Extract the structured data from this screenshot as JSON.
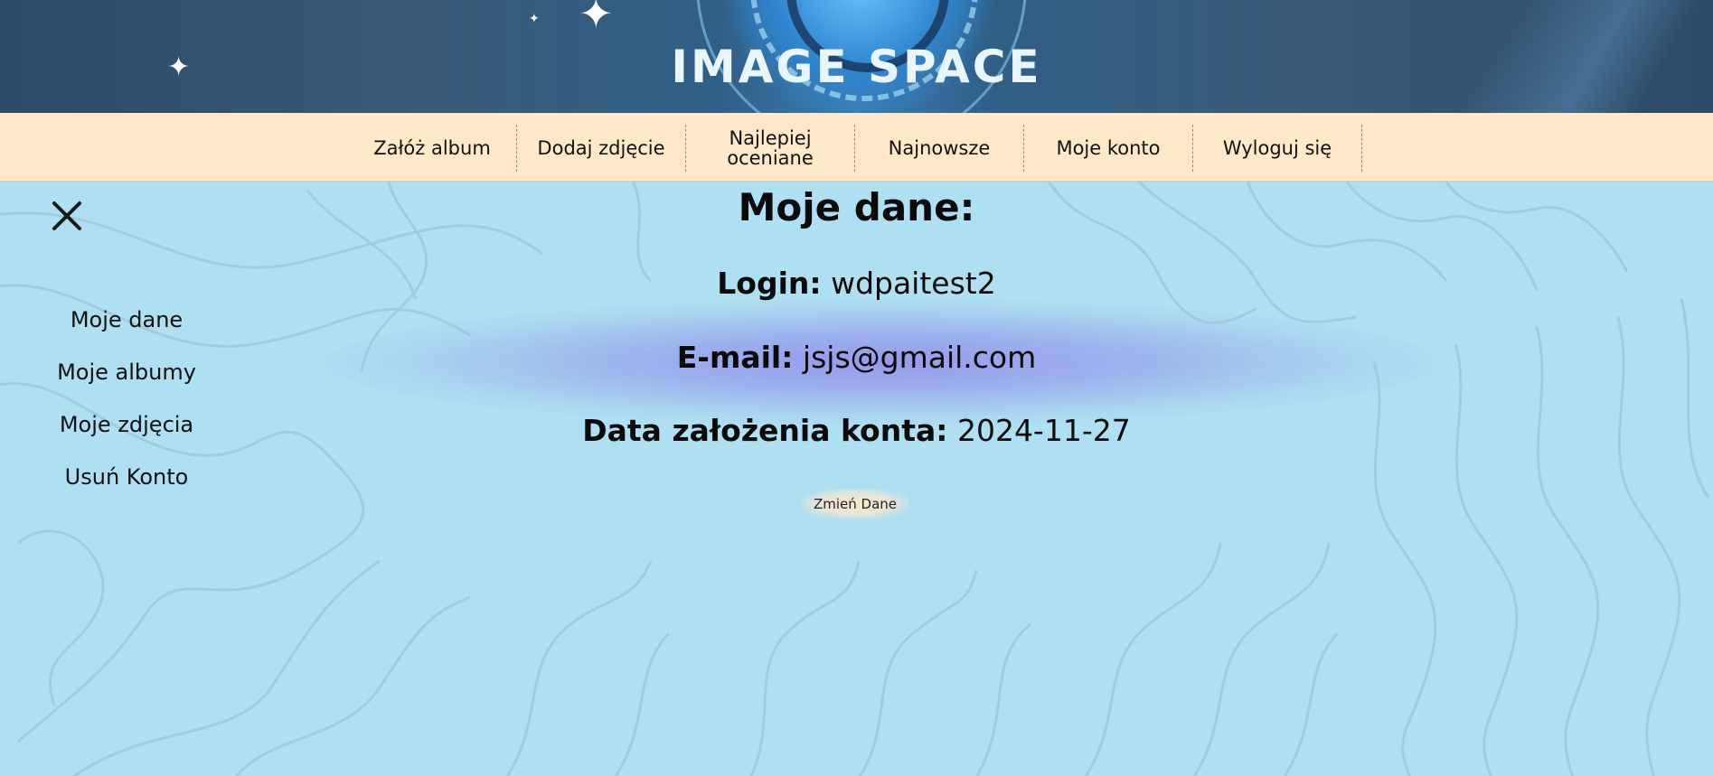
{
  "header": {
    "brand": "IMAGE SPACE"
  },
  "nav": {
    "items": [
      {
        "line1": "Załóż album",
        "line2": ""
      },
      {
        "line1": "Dodaj zdjęcie",
        "line2": ""
      },
      {
        "line1": "Najlepiej",
        "line2": "oceniane"
      },
      {
        "line1": "Najnowsze",
        "line2": ""
      },
      {
        "line1": "Moje konto",
        "line2": ""
      },
      {
        "line1": "Wyloguj się",
        "line2": ""
      }
    ]
  },
  "sidebar": {
    "close_icon": "close-icon",
    "items": [
      {
        "label": "Moje dane"
      },
      {
        "label": "Moje albumy"
      },
      {
        "label": "Moje zdjęcia"
      },
      {
        "label": "Usuń Konto"
      }
    ]
  },
  "main": {
    "title": "Moje dane:",
    "login_label": "Login:",
    "login_value": "wdpaitest2",
    "email_label": "E-mail:",
    "email_value": "jsjs@gmail.com",
    "created_label": "Data założenia konta:",
    "created_value": "2024-11-27",
    "change_button": "Zmień Dane"
  },
  "colors": {
    "background": "#aee0f2",
    "nav_background": "#ffe9c8",
    "banner": "#2d4a66",
    "glow": "#9b9be8"
  }
}
